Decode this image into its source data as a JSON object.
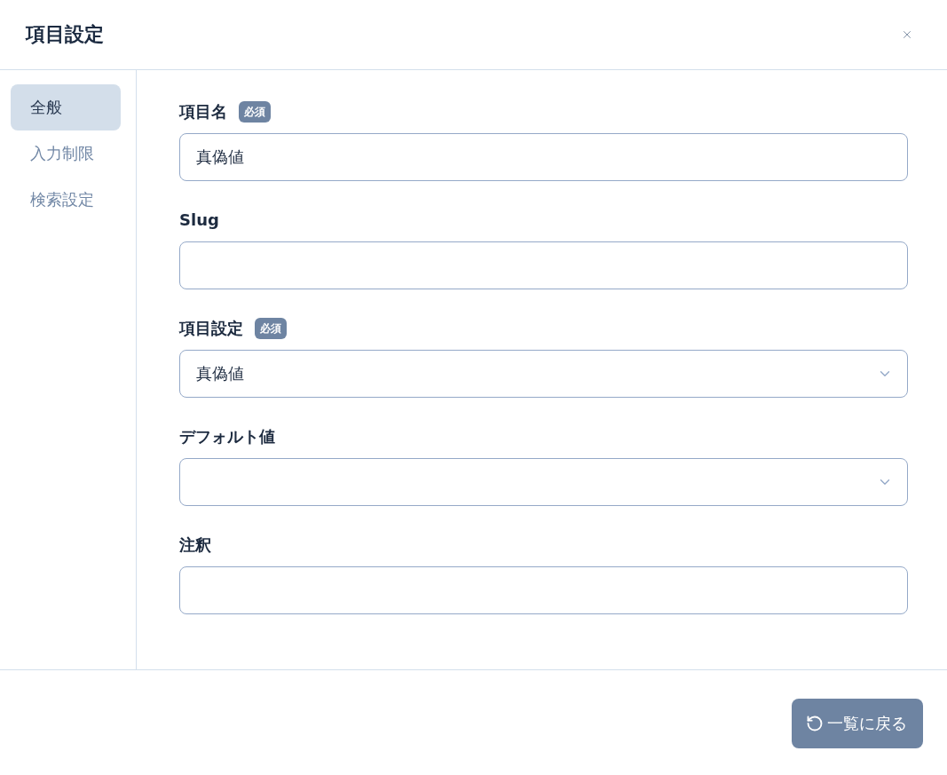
{
  "dialog": {
    "title": "項目設定"
  },
  "sidebar": {
    "items": [
      {
        "label": "全般",
        "selected": true
      },
      {
        "label": "入力制限",
        "selected": false
      },
      {
        "label": "検索設定",
        "selected": false
      }
    ]
  },
  "form": {
    "fields": [
      {
        "kind": "text",
        "label": "項目名",
        "badge": "必須",
        "value": "真偽値"
      },
      {
        "kind": "text",
        "label": "Slug"
      },
      {
        "kind": "select",
        "label": "項目設定",
        "badge": "必須",
        "value": "真偽値"
      },
      {
        "kind": "select",
        "label": "デフォルト値"
      },
      {
        "kind": "text",
        "label": "注釈"
      }
    ]
  },
  "footer": {
    "button": {
      "label": "一覧に戻る"
    }
  }
}
